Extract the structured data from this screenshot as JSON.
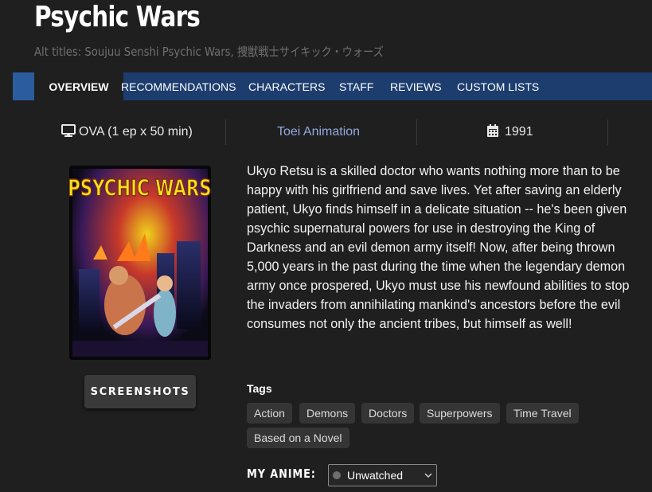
{
  "page": {
    "title": "Psychic Wars",
    "alt_titles": "Alt titles: Soujuu Senshi Psychic Wars, 捜獣戦士サイキック・ウォーズ"
  },
  "tabs": [
    {
      "label": "OVERVIEW",
      "active": true
    },
    {
      "label": "RECOMMENDATIONS",
      "active": false
    },
    {
      "label": "CHARACTERS",
      "active": false
    },
    {
      "label": "STAFF",
      "active": false
    },
    {
      "label": "REVIEWS",
      "active": false
    },
    {
      "label": "CUSTOM LISTS",
      "active": false
    }
  ],
  "info": {
    "type_icon": "monitor-icon",
    "type": "OVA (1 ep x 50 min)",
    "studio": "Toei Animation",
    "year_icon": "calendar-icon",
    "year": "1991"
  },
  "cover": {
    "logo_text": "PSYCHIC WARS"
  },
  "screenshots_button": "SCREENSHOTS",
  "synopsis": "Ukyo Retsu is a skilled doctor who wants nothing more than to be happy with his girlfriend and save lives. Yet after saving an elderly patient, Ukyo finds himself in a delicate situation -- he's been given psychic supernatural powers for use in destroying the King of Darkness and an evil demon army itself! Now, after being thrown 5,000 years in the past during the time when the legendary demon army once prospered, Ukyo must use his newfound abilities to stop the invaders from annihilating mankind's ancestors before the evil consumes not only the ancient tribes, but himself as well!",
  "tags": {
    "label": "Tags",
    "items": [
      "Action",
      "Demons",
      "Doctors",
      "Superpowers",
      "Time Travel",
      "Based on a Novel"
    ]
  },
  "my_anime": {
    "label": "MY ANIME:",
    "status": "Unwatched",
    "status_color": "#6e6e6e"
  },
  "colors": {
    "background": "#1f1f1f",
    "tab_bar": "#1c3d6e",
    "studio_link": "#93a8df",
    "tag_bg": "#353535"
  }
}
